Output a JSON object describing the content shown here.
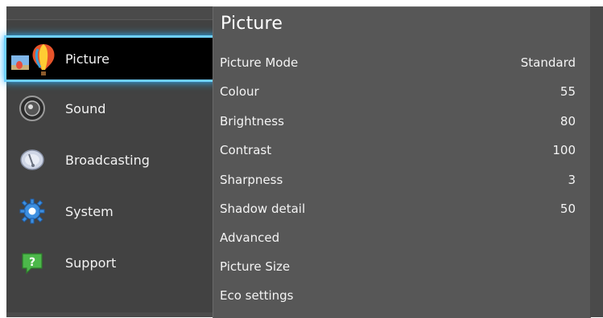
{
  "sidebar": {
    "items": [
      {
        "label": "Picture",
        "icon": "balloon-icon",
        "selected": true
      },
      {
        "label": "Sound",
        "icon": "speaker-icon"
      },
      {
        "label": "Broadcasting",
        "icon": "satellite-dish-icon"
      },
      {
        "label": "System",
        "icon": "gear-icon"
      },
      {
        "label": "Support",
        "icon": "help-icon"
      }
    ]
  },
  "panel": {
    "title": "Picture",
    "rows": [
      {
        "name": "Picture Mode",
        "value": "Standard"
      },
      {
        "name": "Colour",
        "value": "55"
      },
      {
        "name": "Brightness",
        "value": "80"
      },
      {
        "name": "Contrast",
        "value": "100"
      },
      {
        "name": "Sharpness",
        "value": "3"
      },
      {
        "name": "Shadow detail",
        "value": "50"
      },
      {
        "name": "Advanced",
        "value": ""
      },
      {
        "name": "Picture Size",
        "value": ""
      },
      {
        "name": "Eco settings",
        "value": ""
      }
    ]
  },
  "colors": {
    "highlight_glow": "#2ab4ff",
    "sidebar_bg": "#424242",
    "panel_bg": "#575757",
    "text": "#f4f4f4"
  }
}
